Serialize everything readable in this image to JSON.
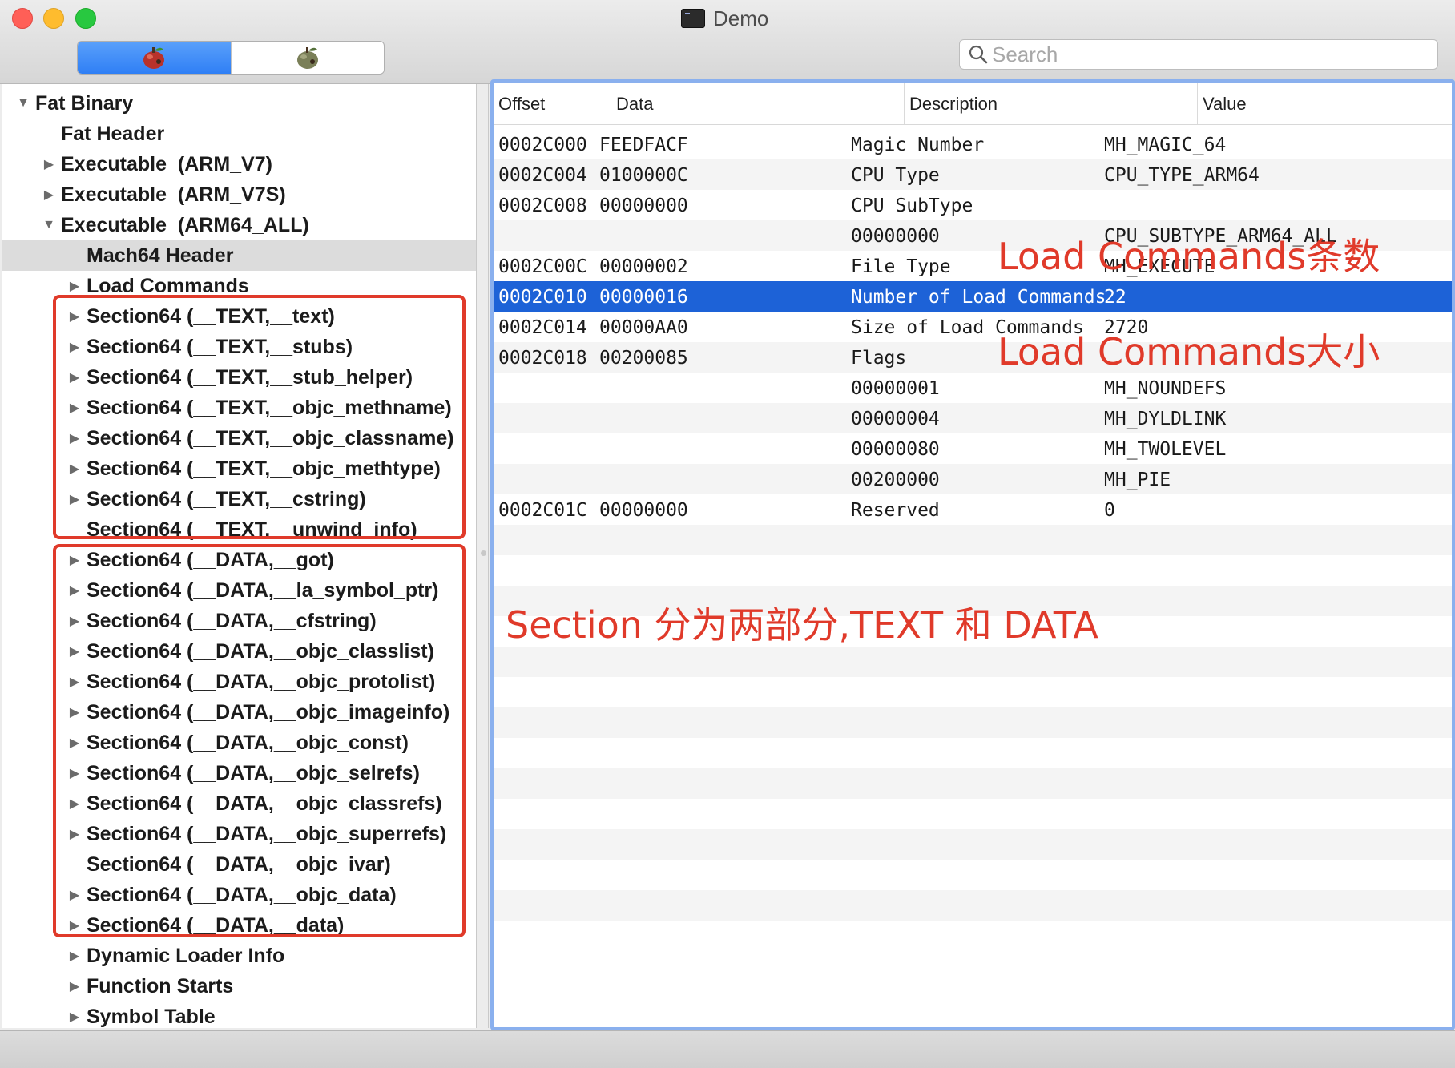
{
  "window": {
    "title": "Demo",
    "search_placeholder": "Search",
    "segments": [
      {
        "icon": "apple-32bit-icon",
        "selected": true
      },
      {
        "icon": "apple-64bit-icon",
        "selected": false
      }
    ]
  },
  "tree": [
    {
      "label": "Fat Binary",
      "depth": 0,
      "arrow": "down"
    },
    {
      "label": "Fat Header",
      "depth": 1,
      "arrow": "none"
    },
    {
      "label": "Executable  (ARM_V7)",
      "depth": 1,
      "arrow": "right"
    },
    {
      "label": "Executable  (ARM_V7S)",
      "depth": 1,
      "arrow": "right"
    },
    {
      "label": "Executable  (ARM64_ALL)",
      "depth": 1,
      "arrow": "down"
    },
    {
      "label": "Mach64 Header",
      "depth": 2,
      "arrow": "none",
      "selected": true
    },
    {
      "label": "Load Commands",
      "depth": 2,
      "arrow": "right"
    },
    {
      "label": "Section64 (__TEXT,__text)",
      "depth": 2,
      "arrow": "right"
    },
    {
      "label": "Section64 (__TEXT,__stubs)",
      "depth": 2,
      "arrow": "right"
    },
    {
      "label": "Section64 (__TEXT,__stub_helper)",
      "depth": 2,
      "arrow": "right"
    },
    {
      "label": "Section64 (__TEXT,__objc_methname)",
      "depth": 2,
      "arrow": "right"
    },
    {
      "label": "Section64 (__TEXT,__objc_classname)",
      "depth": 2,
      "arrow": "right"
    },
    {
      "label": "Section64 (__TEXT,__objc_methtype)",
      "depth": 2,
      "arrow": "right"
    },
    {
      "label": "Section64 (__TEXT,__cstring)",
      "depth": 2,
      "arrow": "right"
    },
    {
      "label": "Section64 (__TEXT,__unwind_info)",
      "depth": 2,
      "arrow": "none"
    },
    {
      "label": "Section64 (__DATA,__got)",
      "depth": 2,
      "arrow": "right"
    },
    {
      "label": "Section64 (__DATA,__la_symbol_ptr)",
      "depth": 2,
      "arrow": "right"
    },
    {
      "label": "Section64 (__DATA,__cfstring)",
      "depth": 2,
      "arrow": "right"
    },
    {
      "label": "Section64 (__DATA,__objc_classlist)",
      "depth": 2,
      "arrow": "right"
    },
    {
      "label": "Section64 (__DATA,__objc_protolist)",
      "depth": 2,
      "arrow": "right"
    },
    {
      "label": "Section64 (__DATA,__objc_imageinfo)",
      "depth": 2,
      "arrow": "right"
    },
    {
      "label": "Section64 (__DATA,__objc_const)",
      "depth": 2,
      "arrow": "right"
    },
    {
      "label": "Section64 (__DATA,__objc_selrefs)",
      "depth": 2,
      "arrow": "right"
    },
    {
      "label": "Section64 (__DATA,__objc_classrefs)",
      "depth": 2,
      "arrow": "right"
    },
    {
      "label": "Section64 (__DATA,__objc_superrefs)",
      "depth": 2,
      "arrow": "right"
    },
    {
      "label": "Section64 (__DATA,__objc_ivar)",
      "depth": 2,
      "arrow": "none"
    },
    {
      "label": "Section64 (__DATA,__objc_data)",
      "depth": 2,
      "arrow": "right"
    },
    {
      "label": "Section64 (__DATA,__data)",
      "depth": 2,
      "arrow": "right"
    },
    {
      "label": "Dynamic Loader Info",
      "depth": 2,
      "arrow": "right"
    },
    {
      "label": "Function Starts",
      "depth": 2,
      "arrow": "right"
    },
    {
      "label": "Symbol Table",
      "depth": 2,
      "arrow": "right"
    }
  ],
  "table": {
    "columns": [
      "Offset",
      "Data",
      "Description",
      "Value"
    ],
    "selected_index": 5,
    "rows": [
      {
        "offset": "0002C000",
        "data": "FEEDFACF",
        "description": "Magic Number",
        "value": "MH_MAGIC_64"
      },
      {
        "offset": "0002C004",
        "data": "0100000C",
        "description": "CPU Type",
        "value": "CPU_TYPE_ARM64"
      },
      {
        "offset": "0002C008",
        "data": "00000000",
        "description": "CPU SubType",
        "value": ""
      },
      {
        "offset": "",
        "data": "",
        "description": "00000000",
        "value": "CPU_SUBTYPE_ARM64_ALL"
      },
      {
        "offset": "0002C00C",
        "data": "00000002",
        "description": "File Type",
        "value": "MH_EXECUTE"
      },
      {
        "offset": "0002C010",
        "data": "00000016",
        "description": "Number of Load Commands",
        "value": "22"
      },
      {
        "offset": "0002C014",
        "data": "00000AA0",
        "description": "Size of Load Commands",
        "value": "2720"
      },
      {
        "offset": "0002C018",
        "data": "00200085",
        "description": "Flags",
        "value": ""
      },
      {
        "offset": "",
        "data": "",
        "description": "00000001",
        "value": "MH_NOUNDEFS"
      },
      {
        "offset": "",
        "data": "",
        "description": "00000004",
        "value": "MH_DYLDLINK"
      },
      {
        "offset": "",
        "data": "",
        "description": "00000080",
        "value": "MH_TWOLEVEL"
      },
      {
        "offset": "",
        "data": "",
        "description": "00200000",
        "value": "MH_PIE"
      },
      {
        "offset": "0002C01C",
        "data": "00000000",
        "description": "Reserved",
        "value": "0"
      }
    ]
  },
  "annotations": {
    "load_commands_count": "Load Commands条数",
    "load_commands_size": "Load Commands大小",
    "sections_note": "Section 分为两部分,TEXT 和 DATA",
    "color": "#e03a2a"
  }
}
